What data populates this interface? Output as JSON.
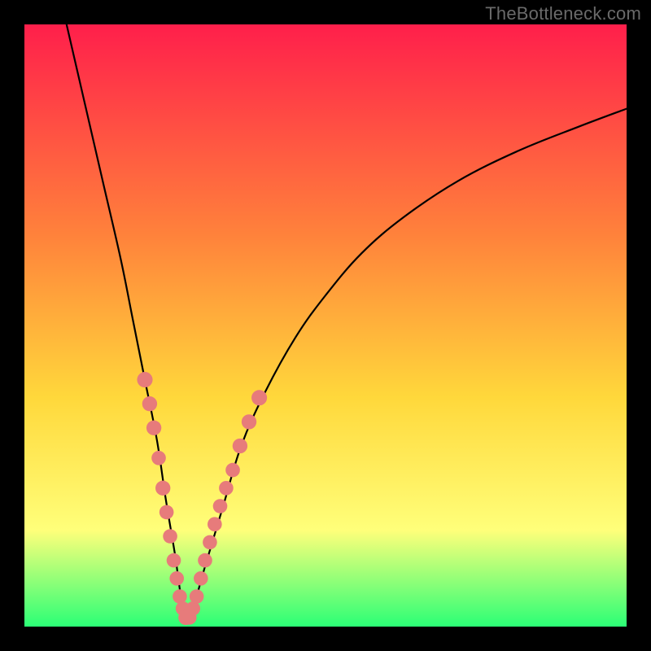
{
  "watermark": "TheBottleneck.com",
  "colors": {
    "frame": "#000000",
    "gradient_top": "#ff1f4b",
    "gradient_mid1": "#ff823b",
    "gradient_mid2": "#ffd83b",
    "gradient_mid3": "#ffff7a",
    "gradient_bottom": "#2bff76",
    "curve": "#000000",
    "marker_fill": "#e77b7b",
    "marker_stroke": "#d96b6b"
  },
  "chart_data": {
    "type": "line",
    "title": "",
    "xlabel": "",
    "ylabel": "",
    "xlim": [
      0,
      100
    ],
    "ylim": [
      0,
      100
    ],
    "grid": false,
    "legend": false,
    "series": [
      {
        "name": "bottleneck-curve",
        "x": [
          7,
          10,
          13,
          16,
          18,
          20,
          22,
          23.5,
          25,
          26,
          27,
          28,
          30,
          33,
          36,
          40,
          45,
          50,
          56,
          63,
          72,
          82,
          92,
          100
        ],
        "y": [
          100,
          87,
          74,
          61,
          51,
          41,
          31,
          21,
          12,
          5,
          1,
          3,
          10,
          20,
          30,
          39,
          48,
          55,
          62,
          68,
          74,
          79,
          83,
          86
        ]
      }
    ],
    "markers": [
      {
        "x": 20.0,
        "y": 41,
        "r": 1.5
      },
      {
        "x": 20.8,
        "y": 37,
        "r": 1.4
      },
      {
        "x": 21.5,
        "y": 33,
        "r": 1.4
      },
      {
        "x": 22.3,
        "y": 28,
        "r": 1.3
      },
      {
        "x": 23.0,
        "y": 23,
        "r": 1.4
      },
      {
        "x": 23.6,
        "y": 19,
        "r": 1.3
      },
      {
        "x": 24.2,
        "y": 15,
        "r": 1.3
      },
      {
        "x": 24.8,
        "y": 11,
        "r": 1.3
      },
      {
        "x": 25.3,
        "y": 8,
        "r": 1.3
      },
      {
        "x": 25.8,
        "y": 5,
        "r": 1.3
      },
      {
        "x": 26.3,
        "y": 3,
        "r": 1.3
      },
      {
        "x": 26.8,
        "y": 1.5,
        "r": 1.4
      },
      {
        "x": 27.4,
        "y": 1.5,
        "r": 1.3
      },
      {
        "x": 28.0,
        "y": 3,
        "r": 1.3
      },
      {
        "x": 28.6,
        "y": 5,
        "r": 1.3
      },
      {
        "x": 29.3,
        "y": 8,
        "r": 1.3
      },
      {
        "x": 30.0,
        "y": 11,
        "r": 1.3
      },
      {
        "x": 30.8,
        "y": 14,
        "r": 1.3
      },
      {
        "x": 31.6,
        "y": 17,
        "r": 1.3
      },
      {
        "x": 32.5,
        "y": 20,
        "r": 1.3
      },
      {
        "x": 33.5,
        "y": 23,
        "r": 1.3
      },
      {
        "x": 34.6,
        "y": 26,
        "r": 1.3
      },
      {
        "x": 35.8,
        "y": 30,
        "r": 1.4
      },
      {
        "x": 37.3,
        "y": 34,
        "r": 1.4
      },
      {
        "x": 39.0,
        "y": 38,
        "r": 1.5
      }
    ]
  }
}
